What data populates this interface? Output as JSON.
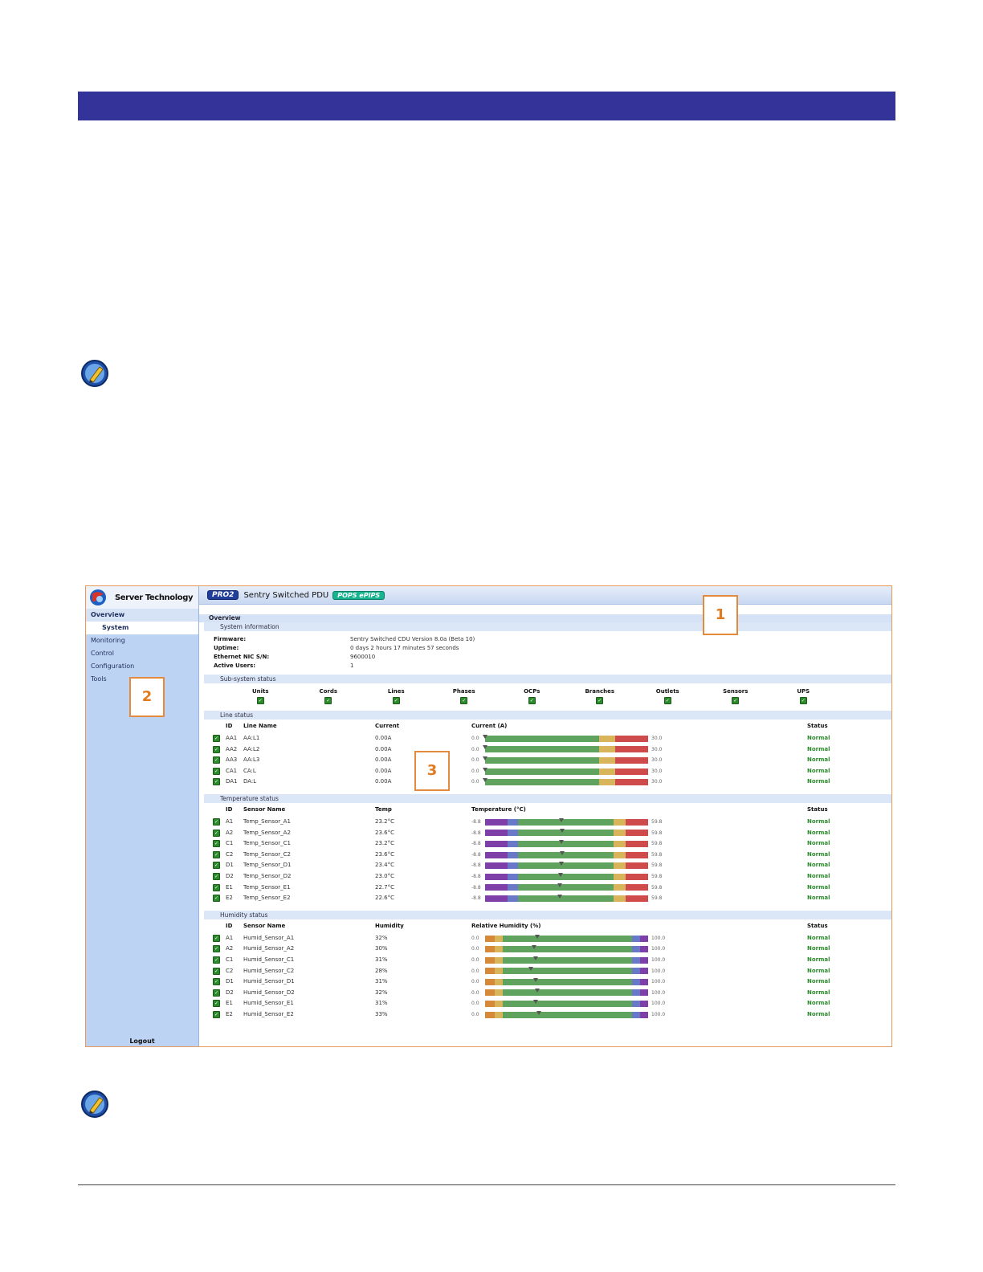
{
  "brand_name": "Server Technology",
  "header": {
    "badge_pro": "PRO2",
    "product_name": "Sentry Switched PDU",
    "badge_pops": "POPS ePIPS"
  },
  "sidebar": {
    "items": [
      {
        "label": "Overview",
        "state": "active-group"
      },
      {
        "label": "System",
        "state": "active"
      },
      {
        "label": "Monitoring",
        "state": ""
      },
      {
        "label": "Control",
        "state": ""
      },
      {
        "label": "Configuration",
        "state": ""
      },
      {
        "label": "Tools",
        "state": ""
      }
    ],
    "logout": "Logout"
  },
  "overview_title": "Overview",
  "system_info": {
    "title": "System information",
    "rows": [
      {
        "label": "Firmware:",
        "value": "Sentry Switched CDU Version 8.0a (Beta 10)"
      },
      {
        "label": "Uptime:",
        "value": "0 days 2 hours 17 minutes 57 seconds"
      },
      {
        "label": "Ethernet NIC S/N:",
        "value": "9600010"
      },
      {
        "label": "Active Users:",
        "value": "1"
      }
    ]
  },
  "subsystem": {
    "title": "Sub-system status",
    "items": [
      "Units",
      "Cords",
      "Lines",
      "Phases",
      "OCPs",
      "Branches",
      "Outlets",
      "Sensors",
      "UPS"
    ]
  },
  "line_status": {
    "title": "Line status",
    "headers": {
      "id": "ID",
      "name": "Line Name",
      "value": "Current",
      "bar": "Current (A)",
      "status": "Status"
    },
    "scale_min": "0.0",
    "scale_max": "30.0",
    "bar_colors": [
      "#5fa35f",
      "#d8b45a",
      "#cf4a4a"
    ],
    "bar_breaks": [
      0.7,
      0.8,
      1.0
    ],
    "rows": [
      {
        "id": "AA1",
        "name": "AA:L1",
        "value": "0.00A",
        "level": 0.0,
        "status": "Normal"
      },
      {
        "id": "AA2",
        "name": "AA:L2",
        "value": "0.00A",
        "level": 0.0,
        "status": "Normal"
      },
      {
        "id": "AA3",
        "name": "AA:L3",
        "value": "0.00A",
        "level": 0.0,
        "status": "Normal"
      },
      {
        "id": "CA1",
        "name": "CA:L",
        "value": "0.00A",
        "level": 0.0,
        "status": "Normal"
      },
      {
        "id": "DA1",
        "name": "DA:L",
        "value": "0.00A",
        "level": 0.0,
        "status": "Normal"
      }
    ]
  },
  "temp_status": {
    "title": "Temperature status",
    "headers": {
      "id": "ID",
      "name": "Sensor Name",
      "value": "Temp",
      "bar": "Temperature (°C)",
      "status": "Status"
    },
    "scale_min": "-8.8",
    "scale_max": "59.8",
    "bar_colors": [
      "#7e3fa8",
      "#6a78c9",
      "#5fa35f",
      "#d8b45a",
      "#cf4a4a"
    ],
    "bar_breaks": [
      0.14,
      0.2,
      0.79,
      0.86,
      1.0
    ],
    "rows": [
      {
        "id": "A1",
        "name": "Temp_Sensor_A1",
        "value": "23.2°C",
        "level": 0.466,
        "status": "Normal"
      },
      {
        "id": "A2",
        "name": "Temp_Sensor_A2",
        "value": "23.6°C",
        "level": 0.472,
        "status": "Normal"
      },
      {
        "id": "C1",
        "name": "Temp_Sensor_C1",
        "value": "23.2°C",
        "level": 0.466,
        "status": "Normal"
      },
      {
        "id": "C2",
        "name": "Temp_Sensor_C2",
        "value": "23.6°C",
        "level": 0.472,
        "status": "Normal"
      },
      {
        "id": "D1",
        "name": "Temp_Sensor_D1",
        "value": "23.4°C",
        "level": 0.469,
        "status": "Normal"
      },
      {
        "id": "D2",
        "name": "Temp_Sensor_D2",
        "value": "23.0°C",
        "level": 0.463,
        "status": "Normal"
      },
      {
        "id": "E1",
        "name": "Temp_Sensor_E1",
        "value": "22.7°C",
        "level": 0.459,
        "status": "Normal"
      },
      {
        "id": "E2",
        "name": "Temp_Sensor_E2",
        "value": "22.6°C",
        "level": 0.457,
        "status": "Normal"
      }
    ]
  },
  "humid_status": {
    "title": "Humidity status",
    "headers": {
      "id": "ID",
      "name": "Sensor Name",
      "value": "Humidity",
      "bar": "Relative Humidity (%)",
      "status": "Status"
    },
    "scale_min": "0.0",
    "scale_max": "100.0",
    "bar_colors": [
      "#d58a3a",
      "#d8b45a",
      "#5fa35f",
      "#6a78c9",
      "#7e3fa8"
    ],
    "bar_breaks": [
      0.06,
      0.11,
      0.9,
      0.95,
      1.0
    ],
    "rows": [
      {
        "id": "A1",
        "name": "Humid_Sensor_A1",
        "value": "32%",
        "level": 0.32,
        "status": "Normal"
      },
      {
        "id": "A2",
        "name": "Humid_Sensor_A2",
        "value": "30%",
        "level": 0.3,
        "status": "Normal"
      },
      {
        "id": "C1",
        "name": "Humid_Sensor_C1",
        "value": "31%",
        "level": 0.31,
        "status": "Normal"
      },
      {
        "id": "C2",
        "name": "Humid_Sensor_C2",
        "value": "28%",
        "level": 0.28,
        "status": "Normal"
      },
      {
        "id": "D1",
        "name": "Humid_Sensor_D1",
        "value": "31%",
        "level": 0.31,
        "status": "Normal"
      },
      {
        "id": "D2",
        "name": "Humid_Sensor_D2",
        "value": "32%",
        "level": 0.32,
        "status": "Normal"
      },
      {
        "id": "E1",
        "name": "Humid_Sensor_E1",
        "value": "31%",
        "level": 0.31,
        "status": "Normal"
      },
      {
        "id": "E2",
        "name": "Humid_Sensor_E2",
        "value": "33%",
        "level": 0.33,
        "status": "Normal"
      }
    ]
  },
  "callouts": [
    "1",
    "2",
    "3"
  ],
  "colors": {
    "banner": "#333399",
    "callout": "#e48a3c",
    "status_ok": "#2b8a2b",
    "sidebar": "#bcd3f4"
  }
}
